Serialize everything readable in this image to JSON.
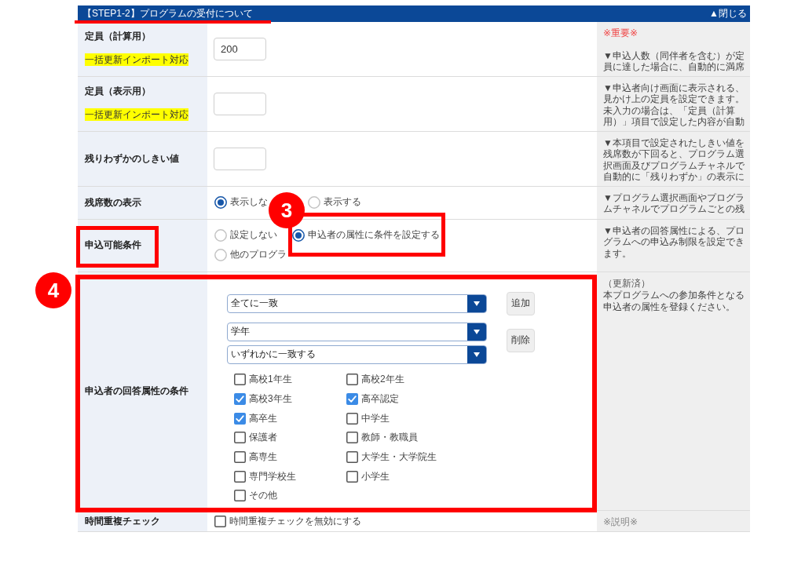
{
  "panel": {
    "title": "【STEP1-2】プログラムの受付について",
    "title_underlined": true,
    "toggle": "▲閉じる",
    "rows": [
      {
        "kind": "input",
        "label": "定員（計算用）",
        "tag": "一括更新インポート対応",
        "label_framed": false,
        "framed": false,
        "value": "200",
        "help": [
          {
            "kind": "important",
            "text": "※重要※"
          },
          {
            "kind": "note",
            "text": "▼申込人数（同伴者を含む）が定員に達した場合に、自動的に満席"
          }
        ]
      },
      {
        "kind": "input",
        "label": "定員（表示用）",
        "tag": "一括更新インポート対応",
        "label_framed": false,
        "framed": false,
        "help": [
          {
            "kind": "note",
            "text": "▼申込者向け画面に表示される、見かけ上の定員を設定できます。未入力の場合は、「定員（計算用）」項目で設定した内容が自動"
          }
        ]
      },
      {
        "kind": "input",
        "label": "残りわずかのしきい値",
        "label_framed": false,
        "framed": false,
        "help": [
          {
            "kind": "note",
            "text": "▼本項目で設定されたしきい値を残席数が下回ると、プログラム選択画面及びプログラムチャネルで自動的に「残りわずか」の表示に"
          }
        ]
      },
      {
        "kind": "radio",
        "label": "残席数の表示",
        "label_framed": false,
        "framed": false,
        "options": [
          {
            "label": "表示しな",
            "selected": true,
            "framed": false
          },
          {
            "label": "表示する",
            "selected": false,
            "framed": false
          }
        ],
        "help": [
          {
            "kind": "note",
            "text": "▼プログラム選択画面やプログラムチャネルでプログラムごとの残"
          }
        ]
      },
      {
        "kind": "radio",
        "label": "申込可能条件",
        "label_framed": true,
        "framed": false,
        "options": [
          {
            "label": "設定しない",
            "selected": false,
            "framed": false
          },
          {
            "label": "申込者の属性に条件を設定する",
            "selected": true,
            "framed": true,
            "step": "3"
          },
          {
            "label": "他のプログラ",
            "selected": false,
            "framed": false
          }
        ],
        "help": [
          {
            "kind": "note",
            "text": "▼申込者の回答属性による、プログラムへの申込み制限を設定できます。"
          }
        ]
      },
      {
        "kind": "conditions",
        "label": "申込者の回答属性の条件",
        "label_framed": false,
        "framed": true,
        "step": "4",
        "match_select": "全てに一致",
        "add_button": "追加",
        "attribute_select": "学年",
        "mode_select": "いずれかに一致する",
        "remove_button": "削除",
        "choices": [
          {
            "label": "高校1年生",
            "checked": false
          },
          {
            "label": "高校2年生",
            "checked": false
          },
          {
            "label": "高校3年生",
            "checked": true
          },
          {
            "label": "高卒認定",
            "checked": true
          },
          {
            "label": "高卒生",
            "checked": true
          },
          {
            "label": "中学生",
            "checked": false
          },
          {
            "label": "保護者",
            "checked": false
          },
          {
            "label": "教師・教職員",
            "checked": false
          },
          {
            "label": "高専生",
            "checked": false
          },
          {
            "label": "大学生・大学院生",
            "checked": false
          },
          {
            "label": "専門学校生",
            "checked": false
          },
          {
            "label": "小学生",
            "checked": false
          },
          {
            "label": "その他",
            "checked": false
          }
        ],
        "help": [
          {
            "kind": "status",
            "text": "（更新済）"
          },
          {
            "kind": "note",
            "text": "本プログラムへの参加条件となる申込者の属性を登録ください。"
          }
        ]
      },
      {
        "kind": "checkbox",
        "label": "時間重複チェック",
        "label_framed": false,
        "framed": false,
        "option": {
          "label": "時間重複チェックを無効にする",
          "checked": false
        },
        "help": [
          {
            "kind": "caption",
            "text": "※説明※"
          }
        ]
      }
    ]
  }
}
